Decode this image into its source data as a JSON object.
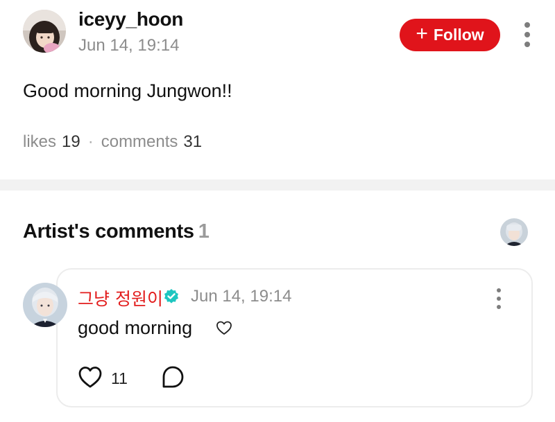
{
  "post": {
    "username": "iceyy_hoon",
    "timestamp": "Jun 14, 19:14",
    "follow_label": "Follow",
    "follow_icon": "plus-icon",
    "text": "Good morning Jungwon!!",
    "likes_label": "likes",
    "likes_count": "19",
    "separator": "·",
    "comments_label": "comments",
    "comments_count": "31"
  },
  "artist_comments": {
    "title": "Artist's comments",
    "count": "1",
    "comment": {
      "author": "그냥 정원이",
      "verified": true,
      "timestamp": "Jun 14, 19:14",
      "text": "good morning",
      "text_icon": "heart-outline-icon",
      "likes_count": "11"
    }
  },
  "colors": {
    "accent": "#e0141b",
    "artist_name": "#e21c1c",
    "verified_badge": "#1ec6c0",
    "muted_text": "#8c8c8c",
    "divider": "#f2f2f2"
  }
}
